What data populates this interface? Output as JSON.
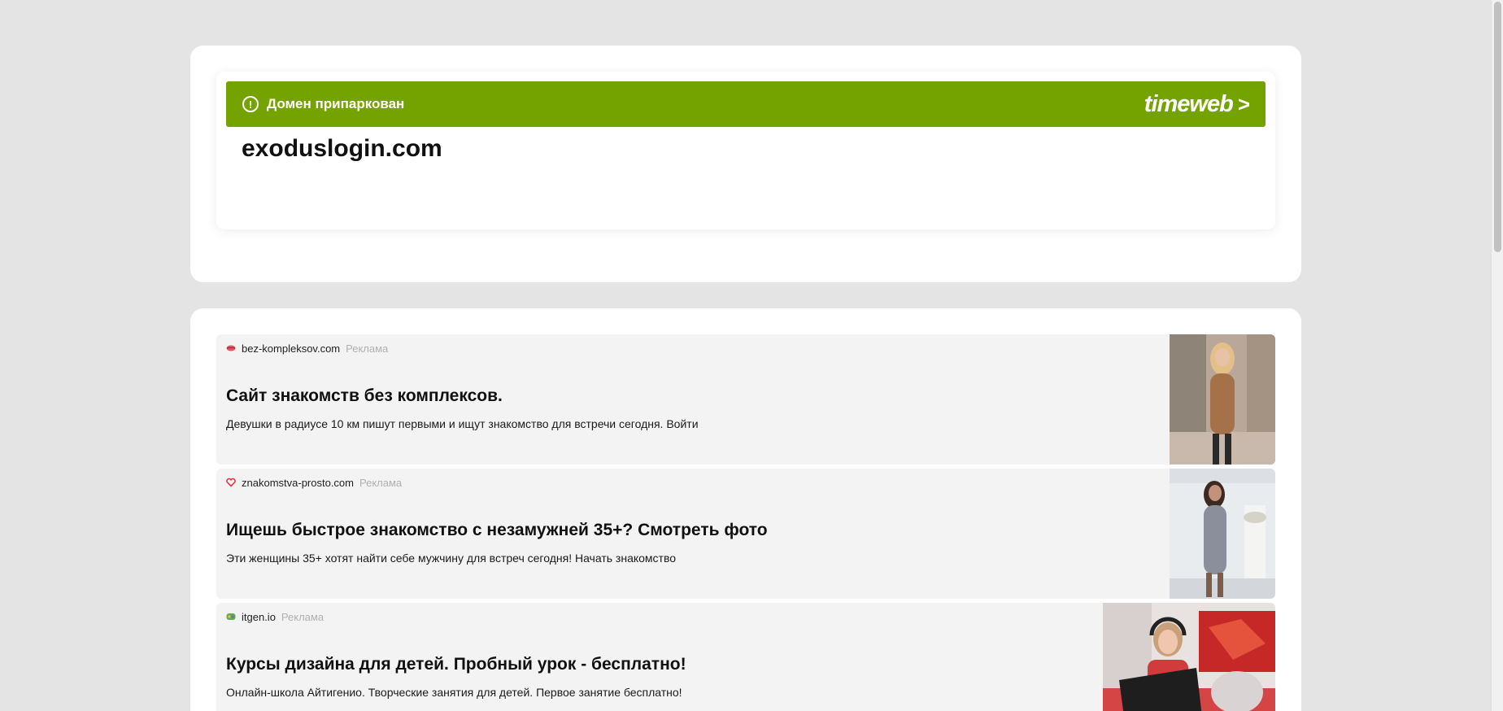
{
  "parking": {
    "status_text": "Домен припаркован",
    "alert_icon": "exclamation-circle-icon",
    "brand": "timeweb",
    "brand_chevron": ">",
    "banner_color": "#74a300"
  },
  "domain": "exoduslogin.com",
  "ads": [
    {
      "favicon": "lips-icon",
      "domain": "bez-kompleksov.com",
      "label": "Реклама",
      "title": "Сайт знакомств без комплексов.",
      "description": "Девушки в радиусе 10 км пишут первыми и ищут знакомство для встречи сегодня. Войти"
    },
    {
      "favicon": "heart-icon",
      "domain": "znakomstva-prosto.com",
      "label": "Реклама",
      "title": "Ищешь быстрое знакомство с незамужней 35+? Смотреть фото",
      "description": "Эти женщины 35+ хотят найти себе мужчину для встреч сегодня! Начать знакомство"
    },
    {
      "favicon": "itgen-logo-icon",
      "domain": "itgen.io",
      "label": "Реклама",
      "title": "Курсы дизайна для детей. Пробный урок - бесплатно!",
      "description": "Онлайн-школа Айтигенио. Творческие занятия для детей. Первое занятие бесплатно!"
    }
  ]
}
